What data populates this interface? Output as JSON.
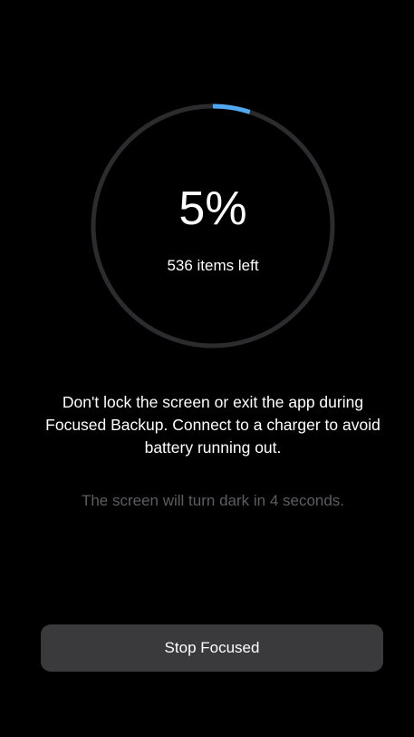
{
  "progress": {
    "percent_label": "5%",
    "fraction": 0.05,
    "items_left": "536 items left",
    "track_color": "#2c2c2e",
    "fill_color": "#4fa8f0"
  },
  "message": {
    "text": "Don't lock the screen or exit the app during Focused Backup. Connect to a charger to avoid battery running out.",
    "countdown": "The screen will turn dark in 4 seconds."
  },
  "actions": {
    "stop_label": "Stop Focused"
  }
}
